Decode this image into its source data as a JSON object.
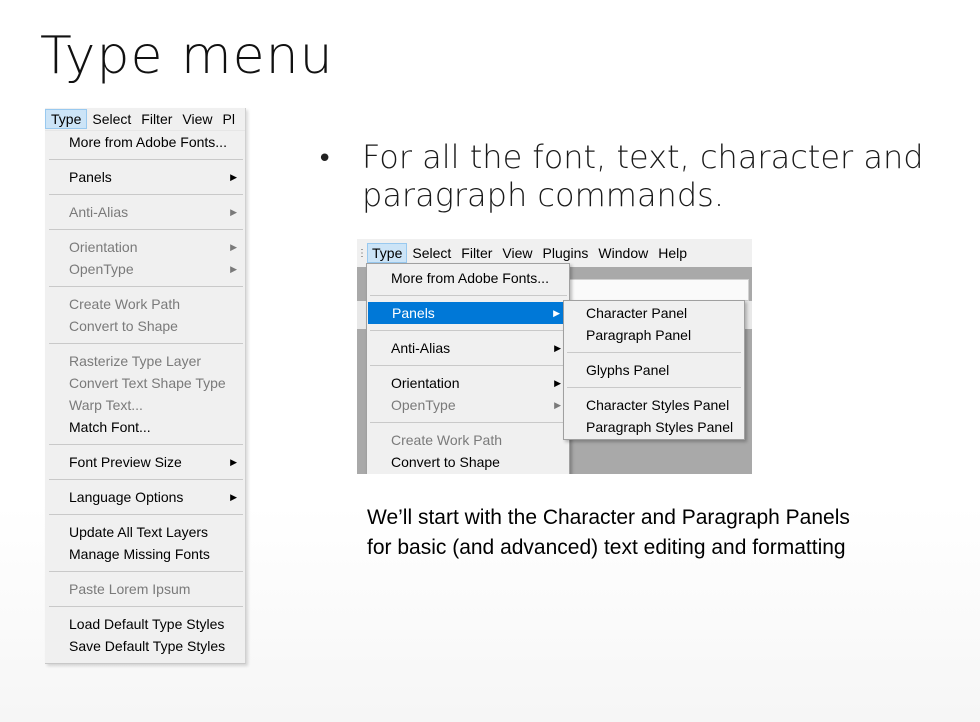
{
  "slide": {
    "title": "Type menu",
    "bullet": "For all the font, text, character and paragraph commands.",
    "caption_line1": "We’ll start with the Character and Paragraph Panels",
    "caption_line2": "for basic (and advanced) text editing and formatting"
  },
  "left_menubar": [
    "Type",
    "Select",
    "Filter",
    "View",
    "Pl"
  ],
  "left_menu": {
    "more_fonts": "More from Adobe Fonts...",
    "panels": "Panels",
    "anti_alias": "Anti-Alias",
    "orientation": "Orientation",
    "opentype": "OpenType",
    "create_work_path": "Create Work Path",
    "convert_to_shape": "Convert to Shape",
    "rasterize": "Rasterize Type Layer",
    "convert_text_shape": "Convert Text Shape Type",
    "warp_text": "Warp Text...",
    "match_font": "Match Font...",
    "font_preview_size": "Font Preview Size",
    "language_options": "Language Options",
    "update_all": "Update All Text Layers",
    "manage_missing": "Manage Missing Fonts",
    "paste_lorem": "Paste Lorem Ipsum",
    "load_default": "Load Default Type Styles",
    "save_default": "Save Default Type Styles"
  },
  "right_menubar": [
    "Type",
    "Select",
    "Filter",
    "View",
    "Plugins",
    "Window",
    "Help"
  ],
  "right_menu": {
    "more_fonts": "More from Adobe Fonts...",
    "panels": "Panels",
    "anti_alias": "Anti-Alias",
    "orientation": "Orientation",
    "opentype": "OpenType",
    "create_work_path": "Create Work Path",
    "convert_to_shape": "Convert to Shape"
  },
  "panels_submenu": {
    "character": "Character Panel",
    "paragraph": "Paragraph Panel",
    "glyphs": "Glyphs Panel",
    "character_styles": "Character Styles Panel",
    "paragraph_styles": "Paragraph Styles Panel"
  },
  "icons": {
    "submenu": "▶",
    "bullet": "•"
  },
  "colors": {
    "highlight": "#0078d7",
    "menu_bg": "#f0f0f0",
    "disabled": "#7a7a7a"
  }
}
